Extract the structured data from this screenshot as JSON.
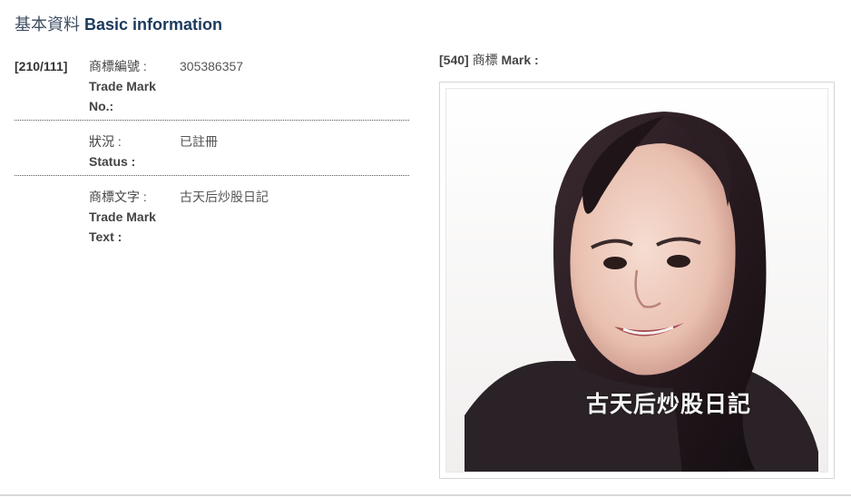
{
  "section": {
    "title_zh": "基本資料",
    "title_en": "Basic information"
  },
  "details": {
    "number": {
      "code": "[210/111]",
      "label_zh": "商標編號 :",
      "label_en": "Trade Mark No.:",
      "value": "305386357"
    },
    "status": {
      "label_zh": "狀況 :",
      "label_en": "Status :",
      "value": "已註冊"
    },
    "text": {
      "label_zh": "商標文字 :",
      "label_en": "Trade Mark Text :",
      "value": "古天后炒股日記"
    }
  },
  "mark": {
    "code": "[540]",
    "label_zh": "商標",
    "label_en": "Mark :",
    "image_caption": "古天后炒股日記"
  },
  "colors": {
    "heading": "#1c3a5e",
    "text": "#444444",
    "rule": "#d9d9d9"
  }
}
